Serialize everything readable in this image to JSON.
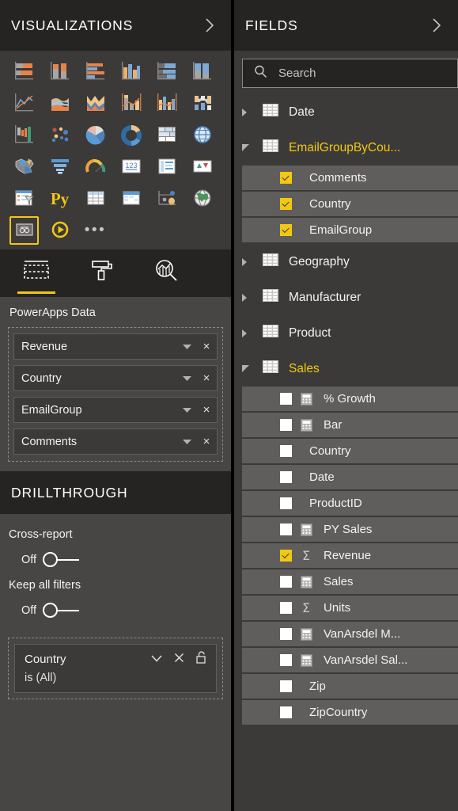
{
  "visualizations": {
    "title": "VISUALIZATIONS",
    "expand_icon": "chevron-right-icon",
    "icons": [
      [
        {
          "name": "stacked-bar-chart",
          "type": "stacked-bar"
        },
        {
          "name": "stacked-column-chart",
          "type": "stacked-column"
        },
        {
          "name": "clustered-bar-chart",
          "type": "clustered-bar"
        },
        {
          "name": "clustered-column-chart",
          "type": "clustered-column"
        },
        {
          "name": "hundred-percent-stacked-bar-chart",
          "type": "pct-bar"
        },
        {
          "name": "hundred-percent-stacked-column-chart",
          "type": "pct-column"
        }
      ],
      [
        {
          "name": "line-chart",
          "type": "line"
        },
        {
          "name": "area-chart",
          "type": "area"
        },
        {
          "name": "stacked-area-chart",
          "type": "stacked-area"
        },
        {
          "name": "line-and-stacked-column-chart",
          "type": "line-stacked-column"
        },
        {
          "name": "line-and-clustered-column-chart",
          "type": "line-clustered-column"
        },
        {
          "name": "ribbon-chart",
          "type": "ribbon"
        }
      ],
      [
        {
          "name": "waterfall-chart",
          "type": "waterfall"
        },
        {
          "name": "scatter-chart",
          "type": "scatter"
        },
        {
          "name": "pie-chart",
          "type": "pie"
        },
        {
          "name": "donut-chart",
          "type": "donut"
        },
        {
          "name": "treemap-chart",
          "type": "treemap"
        },
        {
          "name": "map-visual",
          "type": "map"
        }
      ],
      [
        {
          "name": "filled-map-visual",
          "type": "filled-map"
        },
        {
          "name": "funnel-chart",
          "type": "funnel"
        },
        {
          "name": "gauge-chart",
          "type": "gauge"
        },
        {
          "name": "card-visual",
          "type": "card"
        },
        {
          "name": "multi-row-card-visual",
          "type": "multi-card"
        },
        {
          "name": "kpi-visual",
          "type": "kpi"
        }
      ],
      [
        {
          "name": "slicer-visual",
          "type": "slicer"
        },
        {
          "name": "python-visual",
          "type": "py"
        },
        {
          "name": "table-visual",
          "type": "table"
        },
        {
          "name": "matrix-visual",
          "type": "matrix"
        },
        {
          "name": "r-script-visual",
          "type": "r-script"
        },
        {
          "name": "arcgis-map-visual",
          "type": "arcgis"
        }
      ],
      [
        {
          "name": "powerapps-visual",
          "type": "powerapps",
          "selected": true
        },
        {
          "name": "play-axis-visual",
          "type": "play"
        },
        {
          "name": "more-visuals",
          "type": "more"
        }
      ]
    ],
    "tabs": [
      {
        "name": "fields-tab",
        "icon": "fields-tab-icon",
        "active": true
      },
      {
        "name": "format-tab",
        "icon": "paint-roller-icon",
        "active": false
      },
      {
        "name": "analytics-tab",
        "icon": "analytics-magnifier-icon",
        "active": false
      }
    ],
    "wells_title": "PowerApps Data",
    "wells": [
      {
        "label": "Revenue",
        "caret": "chevron-down-icon",
        "remove": "×"
      },
      {
        "label": "Country",
        "caret": "chevron-down-icon",
        "remove": "×"
      },
      {
        "label": "EmailGroup",
        "caret": "chevron-down-icon",
        "remove": "×"
      },
      {
        "label": "Comments",
        "caret": "chevron-down-icon",
        "remove": "×"
      }
    ]
  },
  "drillthrough": {
    "title": "DRILLTHROUGH",
    "cross_report": {
      "label": "Cross-report",
      "state": "Off"
    },
    "keep_all_filters": {
      "label": "Keep all filters",
      "state": "Off"
    },
    "filter_card": {
      "field": "Country",
      "condition": "is (All)",
      "caret_icon": "chevron-down-icon",
      "remove_icon": "close-icon",
      "lock_icon": "unlock-icon"
    }
  },
  "fields": {
    "title": "FIELDS",
    "expand_icon": "chevron-right-icon",
    "search": {
      "placeholder": "Search",
      "value": "",
      "icon": "search-icon"
    },
    "tables": [
      {
        "name": "Date",
        "expanded": false,
        "active": false,
        "fields": []
      },
      {
        "name": "EmailGroupByCou...",
        "expanded": true,
        "active": true,
        "fields": [
          {
            "label": "Comments",
            "checked": true,
            "icon": "none"
          },
          {
            "label": "Country",
            "checked": true,
            "icon": "none"
          },
          {
            "label": "EmailGroup",
            "checked": true,
            "icon": "none"
          }
        ]
      },
      {
        "name": "Geography",
        "expanded": false,
        "active": false,
        "fields": []
      },
      {
        "name": "Manufacturer",
        "expanded": false,
        "active": false,
        "fields": []
      },
      {
        "name": "Product",
        "expanded": false,
        "active": false,
        "fields": []
      },
      {
        "name": "Sales",
        "expanded": true,
        "active": true,
        "fields": [
          {
            "label": "% Growth",
            "checked": false,
            "icon": "calculator"
          },
          {
            "label": "Bar",
            "checked": false,
            "icon": "calculator"
          },
          {
            "label": "Country",
            "checked": false,
            "icon": "none"
          },
          {
            "label": "Date",
            "checked": false,
            "icon": "none"
          },
          {
            "label": "ProductID",
            "checked": false,
            "icon": "none"
          },
          {
            "label": "PY Sales",
            "checked": false,
            "icon": "calculator"
          },
          {
            "label": "Revenue",
            "checked": true,
            "icon": "sigma"
          },
          {
            "label": "Sales",
            "checked": false,
            "icon": "calculator"
          },
          {
            "label": "Units",
            "checked": false,
            "icon": "sigma"
          },
          {
            "label": "VanArsdel M...",
            "checked": false,
            "icon": "calculator"
          },
          {
            "label": "VanArsdel Sal...",
            "checked": false,
            "icon": "calculator"
          },
          {
            "label": "Zip",
            "checked": false,
            "icon": "none"
          },
          {
            "label": "ZipCountry",
            "checked": false,
            "icon": "none"
          }
        ]
      }
    ]
  },
  "colors": {
    "accent": "#f2c811",
    "panel_dark": "#252423",
    "panel_mid": "#3b3a39",
    "panel_light": "#484644",
    "row": "#605e5c",
    "orange": "#e8834a",
    "blue": "#7fa8d4"
  }
}
